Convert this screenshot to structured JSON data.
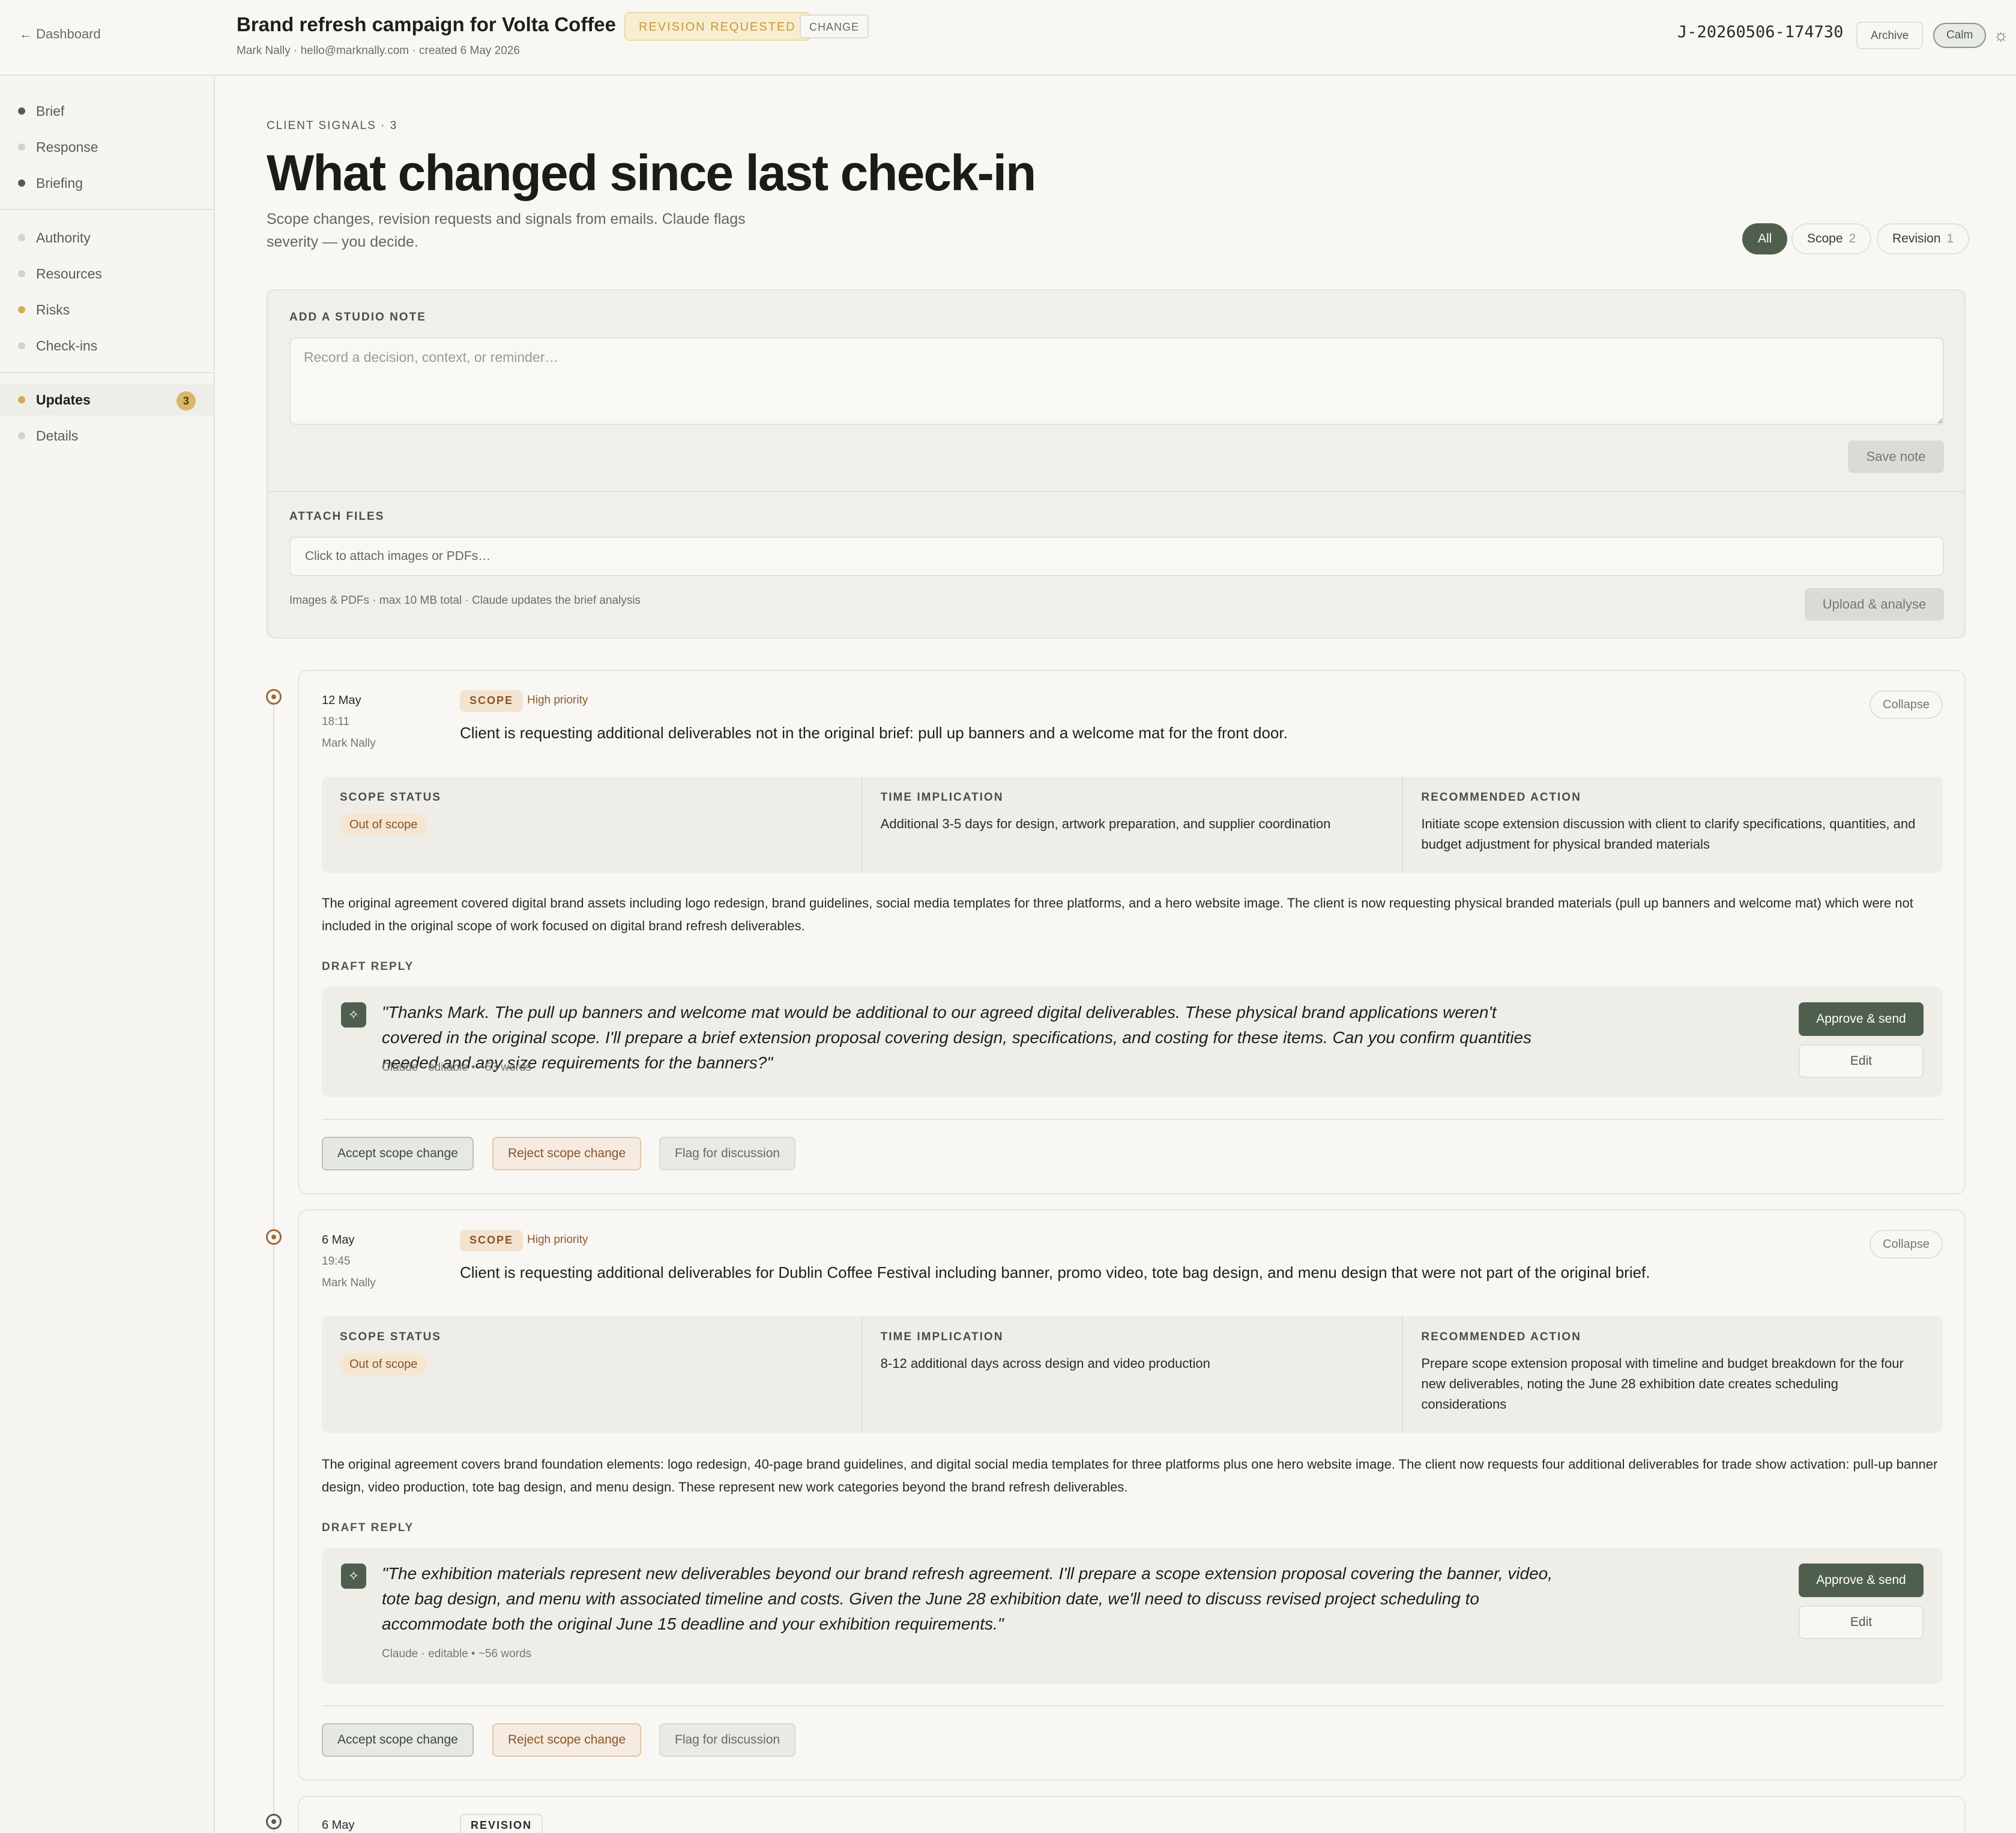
{
  "header": {
    "back_label": "← Dashboard",
    "title": "Brand refresh campaign for Volta Coffee",
    "status_badge": "REVISION REQUESTED",
    "change_label": "CHANGE",
    "subtitle": "Mark Nally · hello@marknally.com · created 6 May 2026",
    "job_id": "J-20260506-174730",
    "archive_label": "Archive",
    "mode_label": "Calm",
    "theme_icon": "sun-icon"
  },
  "sidebar": {
    "items": [
      {
        "label": "Brief",
        "dot": "#4f5f4d"
      },
      {
        "label": "Response",
        "dot": "#d4d2cc"
      },
      {
        "label": "Briefing",
        "dot": "#4f5f4d"
      },
      {
        "label": "Authority",
        "dot": "#d4d2cc"
      },
      {
        "label": "Resources",
        "dot": "#d4d2cc"
      },
      {
        "label": "Risks",
        "dot": "#d4aa5a"
      },
      {
        "label": "Check-ins",
        "dot": "#d4d2cc"
      },
      {
        "label": "Updates",
        "dot": "#d4aa5a",
        "count": "3"
      },
      {
        "label": "Details",
        "dot": "#d4d2cc"
      }
    ]
  },
  "page": {
    "eyebrow": "CLIENT SIGNALS · 3",
    "title": "What changed since last check-in",
    "intro": "Scope changes, revision requests and signals from emails. Claude flags severity — you decide.",
    "filters": [
      {
        "label": "All",
        "count": ""
      },
      {
        "label": "Scope",
        "count": "2"
      },
      {
        "label": "Revision",
        "count": "1"
      }
    ]
  },
  "composer": {
    "note_label": "ADD A STUDIO NOTE",
    "note_placeholder": "Record a decision, context, or reminder…",
    "save_label": "Save note",
    "attach_label": "ATTACH FILES",
    "attach_placeholder": "Click to attach images or PDFs…",
    "limits": "Images & PDFs · max 10 MB total · Claude updates the brief analysis",
    "upload_label": "Upload & analyse"
  },
  "updates": [
    {
      "date": "12 May",
      "time": "18:11",
      "author": "Mark Nally",
      "tag": "SCOPE",
      "priority": "High priority",
      "headline": "Client is requesting additional deliverables not in the original brief: pull up banners and a welcome mat for the front door.",
      "collapse_label": "Collapse",
      "scope_status_label": "SCOPE STATUS",
      "scope_status": "Out of scope",
      "time_label": "TIME IMPLICATION",
      "time_implication": "Additional 3-5 days for design, artwork preparation, and supplier coordination",
      "action_label": "RECOMMENDED ACTION",
      "recommended_action": "Initiate scope extension discussion with client to clarify specifications, quantities, and budget adjustment for physical branded materials",
      "body": "The original agreement covered digital brand assets including logo redesign, brand guidelines, social media templates for three platforms, and a hero website image. The client is now requesting physical branded materials (pull up banners and welcome mat) which were not included in the original scope of work focused on digital brand refresh deliverables.",
      "draft_label": "DRAFT REPLY",
      "draft": "\"Thanks Mark. The pull up banners and welcome mat would be additional to our agreed digital deliverables. These physical brand applications weren't covered in the original scope. I'll prepare a brief extension proposal covering design, specifications, and costing for these items. Can you confirm quantities needed and any size requirements for the banners?\"",
      "draft_meta": "Claude · editable   •   ~53 words",
      "approve_label": "Approve & send",
      "edit_label": "Edit",
      "accept_label": "Accept scope change",
      "reject_label": "Reject scope change",
      "flag_label": "Flag for discussion"
    },
    {
      "date": "6 May",
      "time": "19:45",
      "author": "Mark Nally",
      "tag": "SCOPE",
      "priority": "High priority",
      "headline": "Client is requesting additional deliverables for Dublin Coffee Festival including banner, promo video, tote bag design, and menu design that were not part of the original brief.",
      "collapse_label": "Collapse",
      "scope_status_label": "SCOPE STATUS",
      "scope_status": "Out of scope",
      "time_label": "TIME IMPLICATION",
      "time_implication": "8-12 additional days across design and video production",
      "action_label": "RECOMMENDED ACTION",
      "recommended_action": "Prepare scope extension proposal with timeline and budget breakdown for the four new deliverables, noting the June 28 exhibition date creates scheduling considerations",
      "body": "The original agreement covers brand foundation elements: logo redesign, 40-page brand guidelines, and digital social media templates for three platforms plus one hero website image. The client now requests four additional deliverables for trade show activation: pull-up banner design, video production, tote bag design, and menu design. These represent new work categories beyond the brand refresh deliverables.",
      "draft_label": "DRAFT REPLY",
      "draft": "\"The exhibition materials represent new deliverables beyond our brand refresh agreement. I'll prepare a scope extension proposal covering the banner, video, tote bag design, and menu with associated timeline and costs. Given the June 28 exhibition date, we'll need to discuss revised project scheduling to accommodate both the original June 15 deadline and your exhibition requirements.\"",
      "draft_meta": "Claude · editable   •   ~56 words",
      "approve_label": "Approve & send",
      "edit_label": "Edit",
      "accept_label": "Accept scope change",
      "reject_label": "Reject scope change",
      "flag_label": "Flag for discussion"
    },
    {
      "date": "6 May",
      "tag": "REVISION"
    }
  ]
}
